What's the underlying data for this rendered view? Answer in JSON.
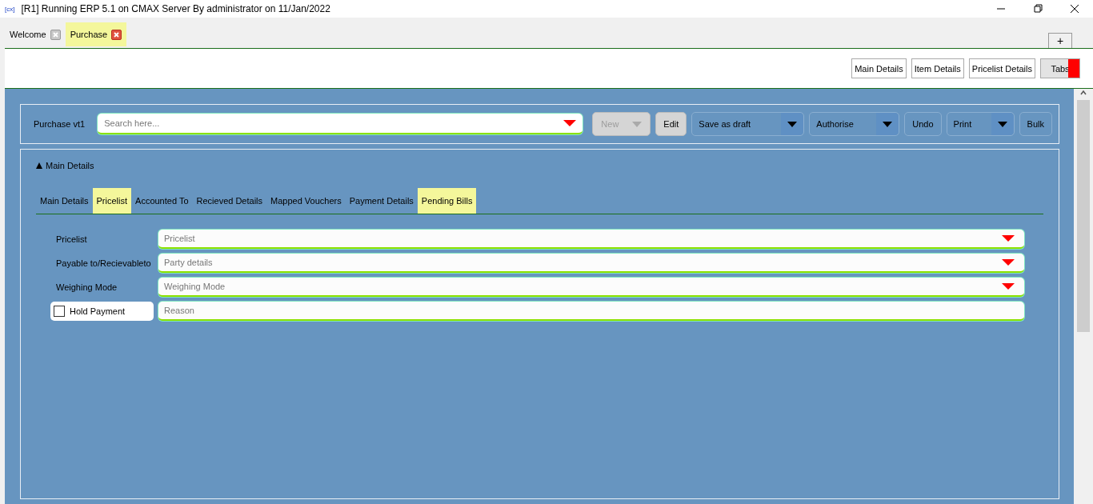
{
  "window": {
    "app_icon": "[cx]",
    "title": "[R1] Running ERP 5.1 on CMAX Server By administrator on 11/Jan/2022"
  },
  "doc_tabs": [
    {
      "label": "Welcome",
      "selected": false
    },
    {
      "label": "Purchase",
      "selected": true
    }
  ],
  "add_tab": "+",
  "section_buttons": [
    {
      "label": "Main Details",
      "kind": "plain"
    },
    {
      "label": "Item Details",
      "kind": "plain"
    },
    {
      "label": "Pricelist Details",
      "kind": "plain"
    },
    {
      "label": "Tabs",
      "kind": "flagged"
    }
  ],
  "toolbar": {
    "title": "Purchase vt1",
    "search": {
      "placeholder": "Search here..."
    },
    "buttons": [
      {
        "label": "New",
        "kind": "select",
        "disabled": true
      },
      {
        "label": "Edit",
        "kind": "solid"
      },
      {
        "label": "Save as draft",
        "kind": "split"
      },
      {
        "label": "Authorise",
        "kind": "split"
      },
      {
        "label": "Undo",
        "kind": "outline"
      },
      {
        "label": "Print",
        "kind": "split"
      },
      {
        "label": "Bulk",
        "kind": "outline"
      }
    ]
  },
  "section": {
    "heading": "Main Details",
    "expanded": true,
    "tabs": [
      {
        "label": "Main Details",
        "highlighted": false
      },
      {
        "label": "Pricelist",
        "highlighted": true
      },
      {
        "label": "Accounted To",
        "highlighted": false
      },
      {
        "label": "Recieved Details",
        "highlighted": false
      },
      {
        "label": "Mapped Vouchers",
        "highlighted": false
      },
      {
        "label": "Payment Details",
        "highlighted": false
      },
      {
        "label": "Pending Bills",
        "highlighted": true
      }
    ],
    "rows": [
      {
        "kind": "dropdown",
        "label": "Pricelist",
        "placeholder": "Pricelist"
      },
      {
        "kind": "dropdown",
        "label": "Payable to/Recievableto",
        "placeholder": "Party details"
      },
      {
        "kind": "dropdown",
        "label": "Weighing Mode",
        "placeholder": "Weighing Mode"
      },
      {
        "kind": "checkbox",
        "label": "Hold Payment",
        "checked": false,
        "placeholder": "Reason"
      }
    ]
  }
}
